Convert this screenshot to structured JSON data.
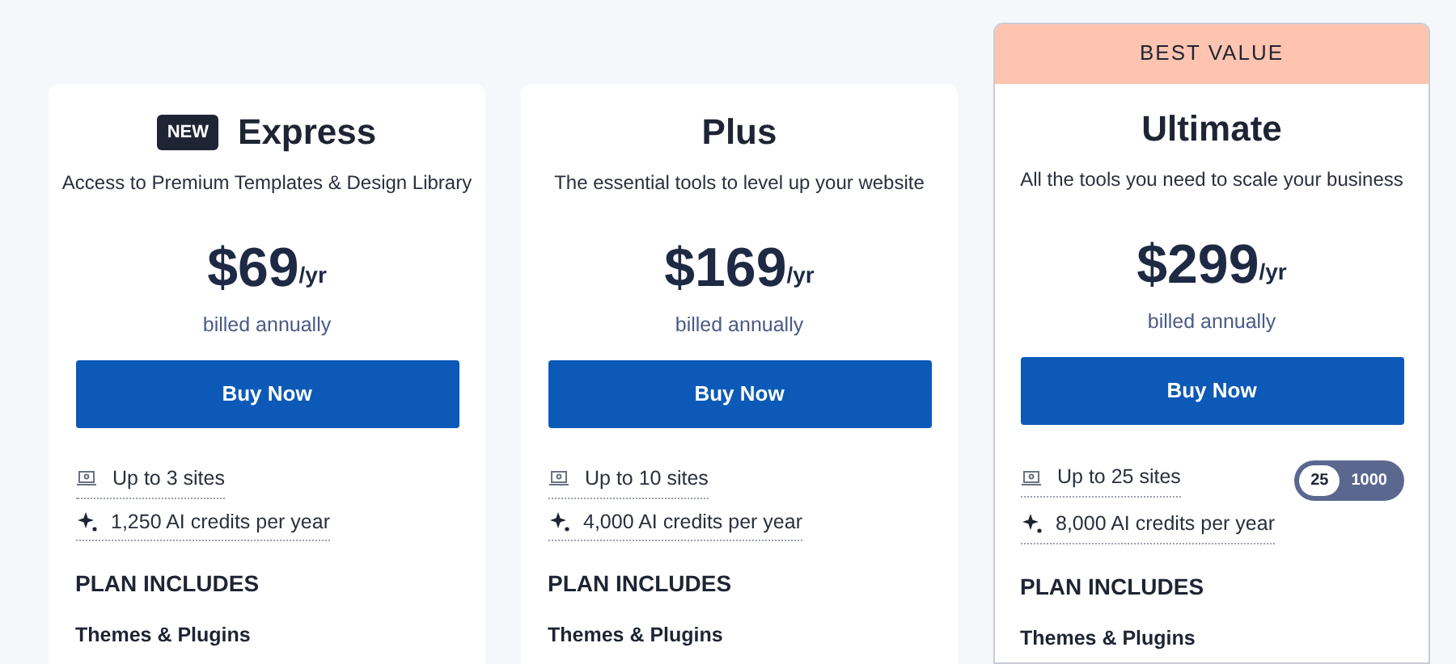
{
  "plans": [
    {
      "name": "Express",
      "badge": "NEW",
      "description": "Access to Premium Templates & Design Library",
      "price": "$69",
      "period": "/yr",
      "billing": "billed annually",
      "button": "Buy Now",
      "sites": "Up to 3 sites",
      "credits": "1,250 AI credits per year",
      "includes_heading": "PLAN INCLUDES",
      "first_include": "Themes & Plugins"
    },
    {
      "name": "Plus",
      "description": "The essential tools to level up your website",
      "price": "$169",
      "period": "/yr",
      "billing": "billed annually",
      "button": "Buy Now",
      "sites": "Up to 10 sites",
      "credits": "4,000 AI credits per year",
      "includes_heading": "PLAN INCLUDES",
      "first_include": "Themes & Plugins"
    },
    {
      "name": "Ultimate",
      "ribbon": "BEST VALUE",
      "description": "All the tools you need to scale your business",
      "price": "$299",
      "period": "/yr",
      "billing": "billed annually",
      "button": "Buy Now",
      "sites": "Up to 25 sites",
      "site_options": [
        {
          "label": "25",
          "selected": true
        },
        {
          "label": "1000",
          "selected": false
        }
      ],
      "credits": "8,000 AI credits per year",
      "includes_heading": "PLAN INCLUDES",
      "first_include": "Themes & Plugins"
    }
  ]
}
